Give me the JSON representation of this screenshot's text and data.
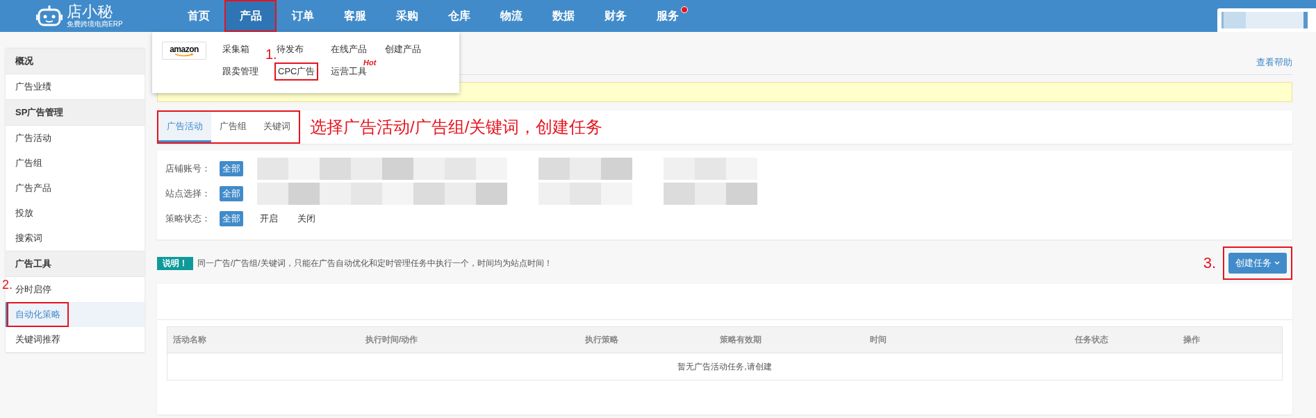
{
  "header": {
    "logo": {
      "name": "店小秘",
      "tagline": "免费跨境电商ERP"
    },
    "nav": [
      {
        "label": "首页",
        "selected": false,
        "highlighted": false,
        "badge": false
      },
      {
        "label": "产品",
        "selected": true,
        "highlighted": true,
        "badge": false
      },
      {
        "label": "订单",
        "selected": false,
        "highlighted": false,
        "badge": false
      },
      {
        "label": "客服",
        "selected": false,
        "highlighted": false,
        "badge": false
      },
      {
        "label": "采购",
        "selected": false,
        "highlighted": false,
        "badge": false
      },
      {
        "label": "仓库",
        "selected": false,
        "highlighted": false,
        "badge": false
      },
      {
        "label": "物流",
        "selected": false,
        "highlighted": false,
        "badge": false
      },
      {
        "label": "数据",
        "selected": false,
        "highlighted": false,
        "badge": false
      },
      {
        "label": "财务",
        "selected": false,
        "highlighted": false,
        "badge": false
      },
      {
        "label": "服务",
        "selected": false,
        "highlighted": false,
        "badge": true
      }
    ]
  },
  "product_menu": {
    "marketplace": "amazon",
    "step": "1.",
    "rows": [
      [
        {
          "label": "采集箱",
          "highlighted": false
        },
        {
          "label": "待发布",
          "highlighted": false
        },
        {
          "label": "在线产品",
          "highlighted": false
        },
        {
          "label": "创建产品",
          "highlighted": false
        }
      ],
      [
        {
          "label": "跟卖管理",
          "highlighted": false
        },
        {
          "label": "CPC广告",
          "highlighted": true
        },
        {
          "label": "运营工具",
          "highlighted": false,
          "hot": "Hot"
        }
      ]
    ]
  },
  "sidebar": {
    "step": "2.",
    "sections": [
      {
        "title": "概况",
        "items": [
          {
            "label": "广告业绩",
            "selected": false,
            "highlighted": false
          }
        ]
      },
      {
        "title": "SP广告管理",
        "items": [
          {
            "label": "广告活动",
            "selected": false,
            "highlighted": false
          },
          {
            "label": "广告组",
            "selected": false,
            "highlighted": false
          },
          {
            "label": "广告产品",
            "selected": false,
            "highlighted": false
          },
          {
            "label": "投放",
            "selected": false,
            "highlighted": false
          },
          {
            "label": "搜索词",
            "selected": false,
            "highlighted": false
          }
        ]
      },
      {
        "title": "广告工具",
        "items": [
          {
            "label": "分时启停",
            "selected": false,
            "highlighted": false
          },
          {
            "label": "自动化策略",
            "selected": true,
            "highlighted": true
          },
          {
            "label": "关键词推荐",
            "selected": false,
            "highlighted": false
          }
        ]
      }
    ]
  },
  "help_link": "查看帮助",
  "tabs": {
    "highlighted": true,
    "instruction": "选择广告活动/广告组/关键词，创建任务",
    "items": [
      {
        "label": "广告活动",
        "selected": true
      },
      {
        "label": "广告组",
        "selected": false
      },
      {
        "label": "关键词",
        "selected": false
      }
    ]
  },
  "filters": [
    {
      "label": "店铺账号：",
      "options": [
        {
          "label": "全部",
          "selected": true
        }
      ],
      "values": {
        "kind": "picture"
      }
    },
    {
      "label": "站点选择：",
      "options": [
        {
          "label": "全部",
          "selected": true
        }
      ],
      "values": {
        "kind": "picture"
      }
    },
    {
      "label": "策略状态：",
      "options": [
        {
          "label": "全部",
          "selected": true
        },
        {
          "label": "开启",
          "selected": false
        },
        {
          "label": "关闭",
          "selected": false
        }
      ]
    }
  ],
  "note": {
    "tag": "说明！",
    "text": "同一广告/广告组/关键词，只能在广告自动优化和定时管理任务中执行一个，时间均为站点时间！"
  },
  "create_button": {
    "label": "创建任务",
    "highlighted": true,
    "step": "3."
  },
  "table": {
    "columns": [
      "活动名称",
      "执行时间/动作",
      "执行策略",
      "策略有效期",
      "时间",
      "任务状态",
      "操作"
    ],
    "empty_text": "暂无广告活动任务,请创建"
  }
}
